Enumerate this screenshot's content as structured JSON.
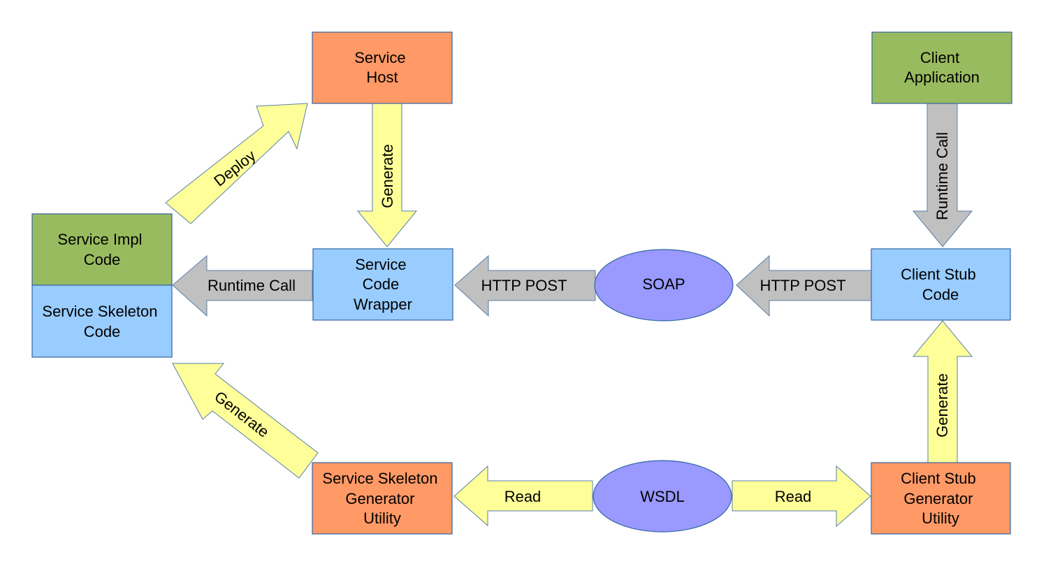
{
  "colors": {
    "service_host": "#ff9966",
    "generator": "#ff9966",
    "client_app": "#99bb5f",
    "service_impl": "#99bb5f",
    "code_box": "#99ccff",
    "ellipse": "#9999ff",
    "arrow_yellow": "#ffff99",
    "arrow_gray": "#c0c0c0"
  },
  "nodes": {
    "service_host": [
      "Service",
      "Host"
    ],
    "client_application": [
      "Client",
      "Application"
    ],
    "service_impl_code": [
      "Service Impl",
      "Code"
    ],
    "service_skeleton_code": [
      "Service Skeleton",
      "Code"
    ],
    "service_code_wrapper": [
      "Service",
      "Code",
      "Wrapper"
    ],
    "soap": "SOAP",
    "client_stub_code": [
      "Client Stub",
      "Code"
    ],
    "service_skeleton_generator": [
      "Service Skeleton",
      "Generator",
      "Utility"
    ],
    "wsdl": "WSDL",
    "client_stub_generator": [
      "Client Stub",
      "Generator",
      "Utility"
    ]
  },
  "edges": {
    "deploy": "Deploy",
    "host_generate": "Generate",
    "client_runtime_call": "Runtime Call",
    "wrapper_runtime_call": "Runtime Call",
    "http_post_left": "HTTP POST",
    "http_post_right": "HTTP POST",
    "skeleton_generate": "Generate",
    "stub_generate": "Generate",
    "read_left": "Read",
    "read_right": "Read"
  }
}
